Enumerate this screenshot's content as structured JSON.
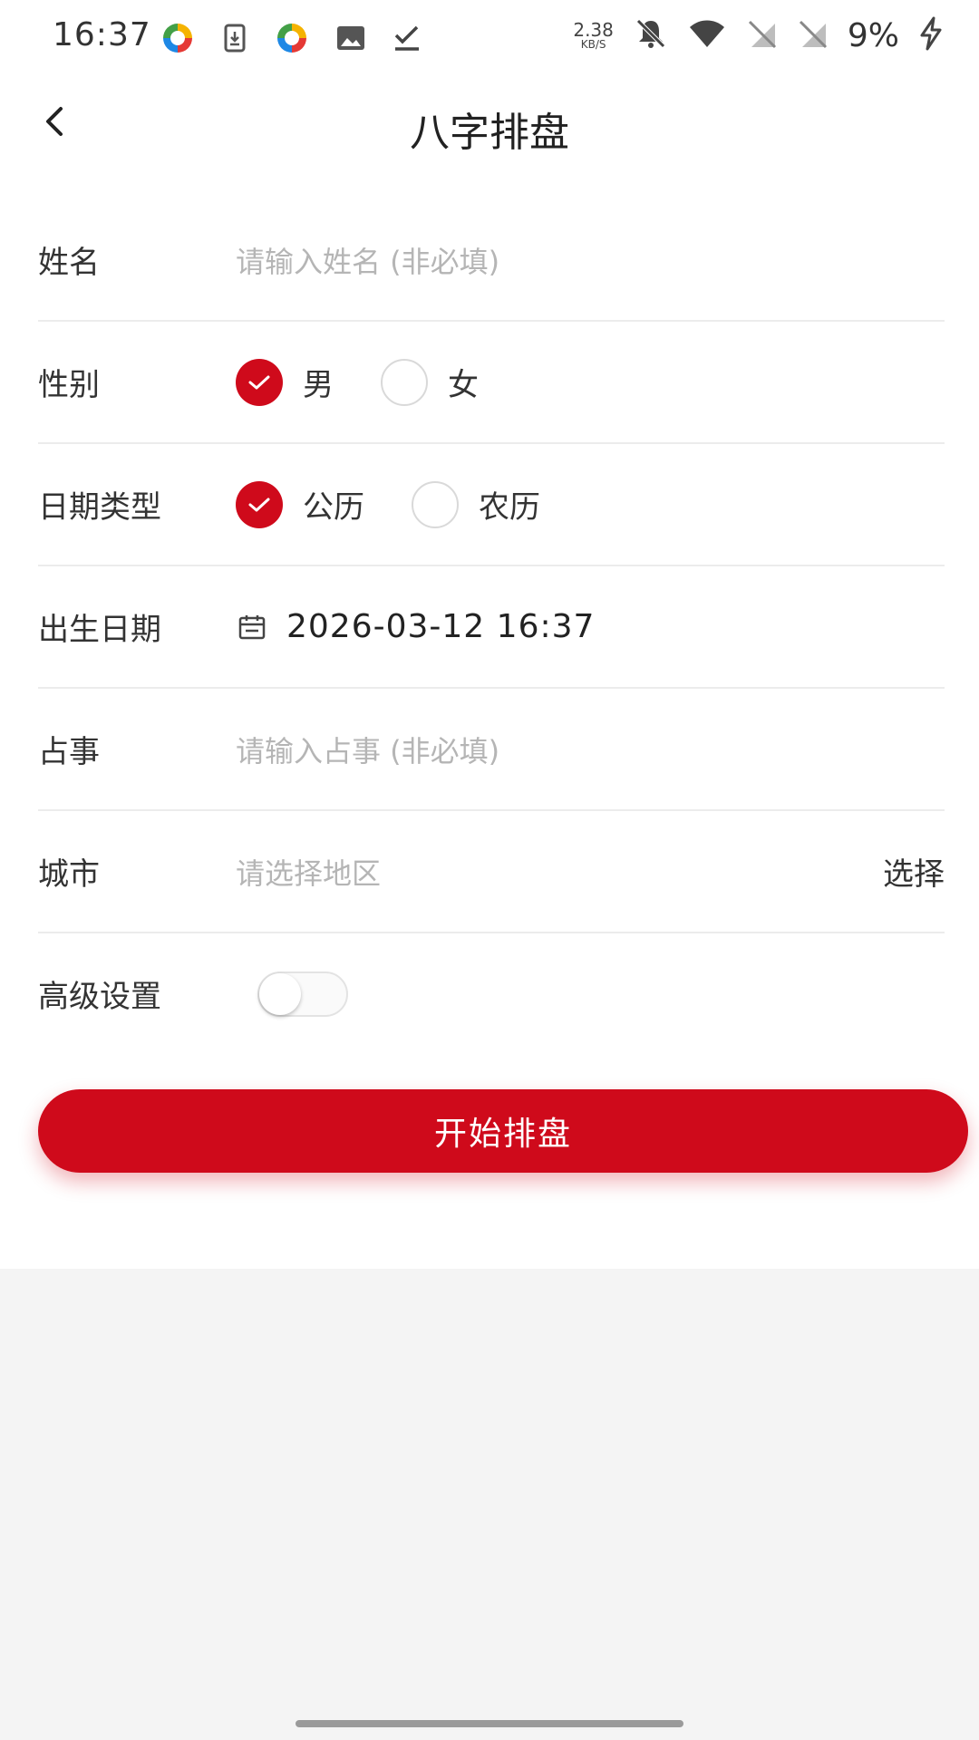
{
  "status_bar": {
    "time": "16:37",
    "net_speed_value": "2.38",
    "net_speed_unit": "KB/S",
    "battery": "9%",
    "icons": [
      "colorful-app-icon",
      "download-icon",
      "colorful-app-icon",
      "image-icon",
      "checkmark-icon",
      "mute-bell-icon",
      "wifi-icon",
      "no-sim-icon",
      "no-sim-icon",
      "charging-bolt-icon"
    ]
  },
  "header": {
    "title": "八字排盘"
  },
  "form": {
    "name": {
      "label": "姓名",
      "placeholder": "请输入姓名 (非必填)"
    },
    "gender": {
      "label": "性别",
      "options": [
        {
          "label": "男",
          "checked": true
        },
        {
          "label": "女",
          "checked": false
        }
      ]
    },
    "date_type": {
      "label": "日期类型",
      "options": [
        {
          "label": "公历",
          "checked": true
        },
        {
          "label": "农历",
          "checked": false
        }
      ]
    },
    "birth_date": {
      "label": "出生日期",
      "value": "2026-03-12 16:37"
    },
    "matter": {
      "label": "占事",
      "placeholder": "请输入占事 (非必填)"
    },
    "city": {
      "label": "城市",
      "placeholder": "请选择地区",
      "action": "选择"
    },
    "advanced": {
      "label": "高级设置",
      "enabled": false
    }
  },
  "submit": {
    "label": "开始排盘"
  },
  "colors": {
    "accent": "#cf0a1b",
    "placeholder": "#b5b5b5",
    "divider": "#ececec"
  }
}
